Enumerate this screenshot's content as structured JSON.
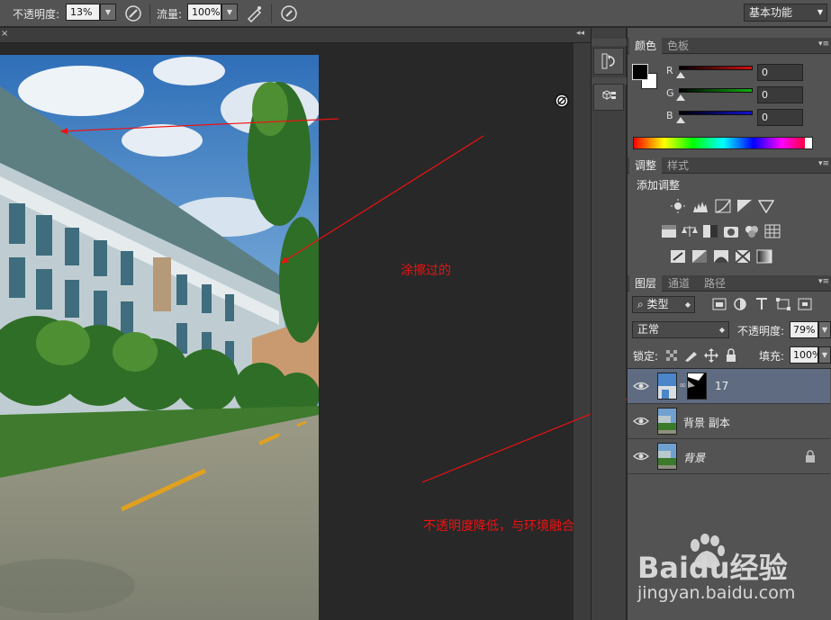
{
  "options_bar": {
    "opacity_label": "不透明度:",
    "opacity_value": "13%",
    "flow_label": "流量:",
    "flow_value": "100%",
    "workspace": "基本功能"
  },
  "annotations": {
    "smeared": "涂擦过的",
    "lowered": "不透明度降低，与环境融合"
  },
  "color_panel": {
    "tabs": [
      "颜色",
      "色板"
    ],
    "channels": [
      {
        "label": "R",
        "value": "0"
      },
      {
        "label": "G",
        "value": "0"
      },
      {
        "label": "B",
        "value": "0"
      }
    ],
    "colors": {
      "r": "#d01010",
      "g": "#10b010",
      "b": "#1010d0"
    }
  },
  "adjust_panel": {
    "tabs": [
      "调整",
      "样式"
    ],
    "heading": "添加调整"
  },
  "layers_panel": {
    "tabs": [
      "图层",
      "通道",
      "路径"
    ],
    "filter_kind": "类型",
    "blend_mode": "正常",
    "opacity_label": "不透明度:",
    "opacity_value": "79%",
    "lock_label": "锁定:",
    "fill_label": "填充:",
    "fill_value": "100%",
    "layers": [
      {
        "name": "17",
        "selected": true
      },
      {
        "name": "背景 副本",
        "selected": false
      },
      {
        "name": "背景",
        "selected": false
      }
    ]
  },
  "watermark": {
    "brand": "Baidu经验",
    "url": "jingyan.baidu.com"
  }
}
